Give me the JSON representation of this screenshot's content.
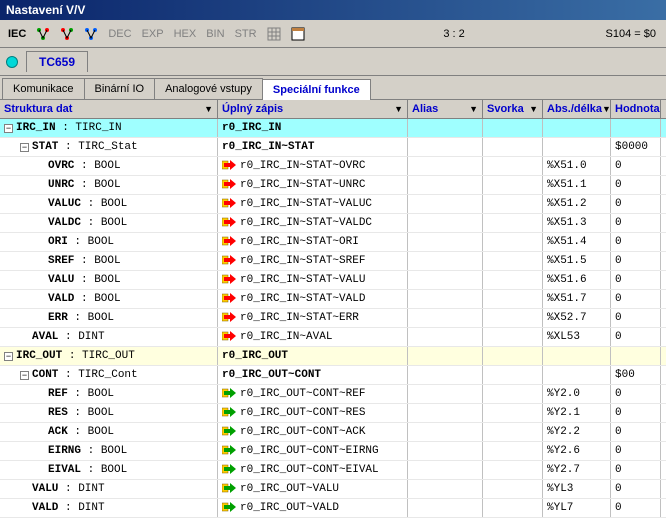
{
  "titlebar": "Nastavení V/V",
  "toolbar": {
    "iec": "IEC",
    "dec": "DEC",
    "exp": "EXP",
    "hex": "HEX",
    "bin": "BIN",
    "str": "STR",
    "ratio": "3 : 2",
    "status": "S104 = $0"
  },
  "device": {
    "name": "TC659"
  },
  "tabs": {
    "komunikace": "Komunikace",
    "binarni": "Binární IO",
    "analogove": "Analogové vstupy",
    "specialni": "Speciální funkce"
  },
  "headers": {
    "struktura": "Struktura dat",
    "zapis": "Úplný zápis",
    "alias": "Alias",
    "svorka": "Svorka",
    "abs": "Abs./délka",
    "hodnota": "Hodnota"
  },
  "rows": [
    {
      "lvl": 0,
      "exp": "-",
      "name": "IRC_IN",
      "type": "TIRC_IN",
      "zapis": "r0_IRC_IN",
      "abs": "",
      "hod": "",
      "cls": "cyan",
      "icon": ""
    },
    {
      "lvl": 1,
      "exp": "-",
      "name": "STAT",
      "type": "TIRC_Stat",
      "zapis": "r0_IRC_IN~STAT",
      "abs": "",
      "hod": "$0000",
      "cls": "",
      "icon": ""
    },
    {
      "lvl": 2,
      "exp": "",
      "name": "OVRC",
      "type": "BOOL",
      "zapis": "r0_IRC_IN~STAT~OVRC",
      "abs": "%X51.0",
      "hod": "0",
      "cls": "",
      "icon": "in"
    },
    {
      "lvl": 2,
      "exp": "",
      "name": "UNRC",
      "type": "BOOL",
      "zapis": "r0_IRC_IN~STAT~UNRC",
      "abs": "%X51.1",
      "hod": "0",
      "cls": "",
      "icon": "in"
    },
    {
      "lvl": 2,
      "exp": "",
      "name": "VALUC",
      "type": "BOOL",
      "zapis": "r0_IRC_IN~STAT~VALUC",
      "abs": "%X51.2",
      "hod": "0",
      "cls": "",
      "icon": "in"
    },
    {
      "lvl": 2,
      "exp": "",
      "name": "VALDC",
      "type": "BOOL",
      "zapis": "r0_IRC_IN~STAT~VALDC",
      "abs": "%X51.3",
      "hod": "0",
      "cls": "",
      "icon": "in"
    },
    {
      "lvl": 2,
      "exp": "",
      "name": "ORI",
      "type": "BOOL",
      "zapis": "r0_IRC_IN~STAT~ORI",
      "abs": "%X51.4",
      "hod": "0",
      "cls": "",
      "icon": "in"
    },
    {
      "lvl": 2,
      "exp": "",
      "name": "SREF",
      "type": "BOOL",
      "zapis": "r0_IRC_IN~STAT~SREF",
      "abs": "%X51.5",
      "hod": "0",
      "cls": "",
      "icon": "in"
    },
    {
      "lvl": 2,
      "exp": "",
      "name": "VALU",
      "type": "BOOL",
      "zapis": "r0_IRC_IN~STAT~VALU",
      "abs": "%X51.6",
      "hod": "0",
      "cls": "",
      "icon": "in"
    },
    {
      "lvl": 2,
      "exp": "",
      "name": "VALD",
      "type": "BOOL",
      "zapis": "r0_IRC_IN~STAT~VALD",
      "abs": "%X51.7",
      "hod": "0",
      "cls": "",
      "icon": "in"
    },
    {
      "lvl": 2,
      "exp": "",
      "name": "ERR",
      "type": "BOOL",
      "zapis": "r0_IRC_IN~STAT~ERR",
      "abs": "%X52.7",
      "hod": "0",
      "cls": "",
      "icon": "in"
    },
    {
      "lvl": 1,
      "exp": "",
      "name": "AVAL",
      "type": "DINT",
      "zapis": "r0_IRC_IN~AVAL",
      "abs": "%XL53",
      "hod": "0",
      "cls": "",
      "icon": "in"
    },
    {
      "lvl": 0,
      "exp": "-",
      "name": "IRC_OUT",
      "type": "TIRC_OUT",
      "zapis": "r0_IRC_OUT",
      "abs": "",
      "hod": "",
      "cls": "yellow",
      "icon": ""
    },
    {
      "lvl": 1,
      "exp": "-",
      "name": "CONT",
      "type": "TIRC_Cont",
      "zapis": "r0_IRC_OUT~CONT",
      "abs": "",
      "hod": "$00",
      "cls": "",
      "icon": ""
    },
    {
      "lvl": 2,
      "exp": "",
      "name": "REF",
      "type": "BOOL",
      "zapis": "r0_IRC_OUT~CONT~REF",
      "abs": "%Y2.0",
      "hod": "0",
      "cls": "",
      "icon": "out"
    },
    {
      "lvl": 2,
      "exp": "",
      "name": "RES",
      "type": "BOOL",
      "zapis": "r0_IRC_OUT~CONT~RES",
      "abs": "%Y2.1",
      "hod": "0",
      "cls": "",
      "icon": "out"
    },
    {
      "lvl": 2,
      "exp": "",
      "name": "ACK",
      "type": "BOOL",
      "zapis": "r0_IRC_OUT~CONT~ACK",
      "abs": "%Y2.2",
      "hod": "0",
      "cls": "",
      "icon": "out"
    },
    {
      "lvl": 2,
      "exp": "",
      "name": "EIRNG",
      "type": "BOOL",
      "zapis": "r0_IRC_OUT~CONT~EIRNG",
      "abs": "%Y2.6",
      "hod": "0",
      "cls": "",
      "icon": "out"
    },
    {
      "lvl": 2,
      "exp": "",
      "name": "EIVAL",
      "type": "BOOL",
      "zapis": "r0_IRC_OUT~CONT~EIVAL",
      "abs": "%Y2.7",
      "hod": "0",
      "cls": "",
      "icon": "out"
    },
    {
      "lvl": 1,
      "exp": "",
      "name": "VALU",
      "type": "DINT",
      "zapis": "r0_IRC_OUT~VALU",
      "abs": "%YL3",
      "hod": "0",
      "cls": "",
      "icon": "out"
    },
    {
      "lvl": 1,
      "exp": "",
      "name": "VALD",
      "type": "DINT",
      "zapis": "r0_IRC_OUT~VALD",
      "abs": "%YL7",
      "hod": "0",
      "cls": "",
      "icon": "out"
    }
  ]
}
